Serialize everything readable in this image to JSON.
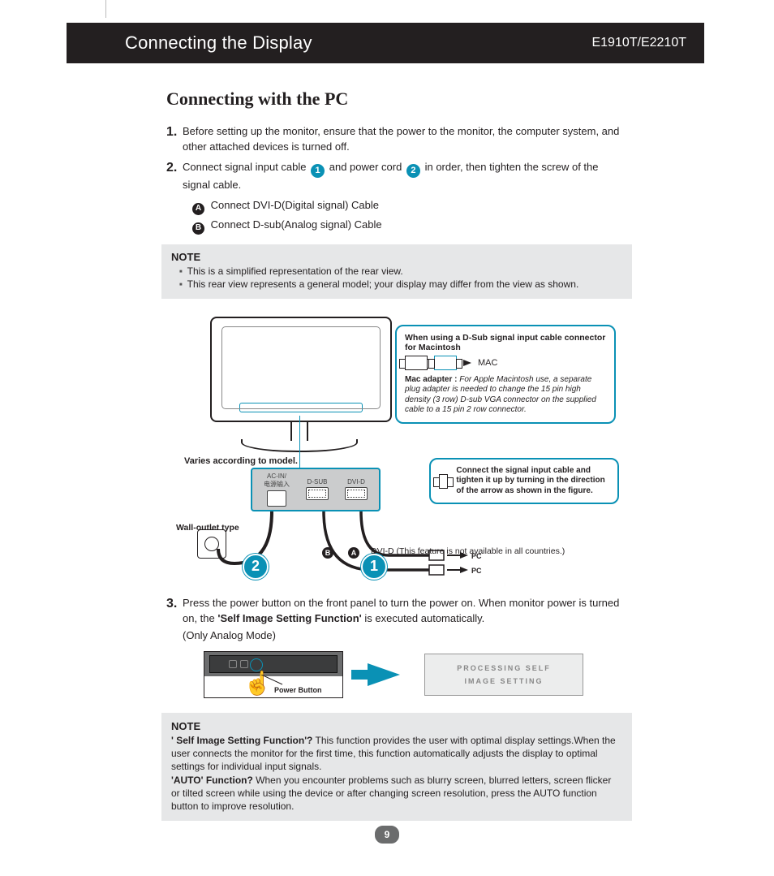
{
  "header": {
    "title": "Connecting the Display",
    "model": "E1910T/E2210T"
  },
  "section_title": "Connecting with the PC",
  "steps": {
    "s1": {
      "num": "1.",
      "text": "Before setting up the monitor, ensure that the power to the monitor, the computer system, and other attached devices is turned off."
    },
    "s2": {
      "num": "2.",
      "pre": "Connect signal input cable ",
      "mid": " and power cord ",
      "post": " in order, then tighten the screw of the signal cable.",
      "badge1": "1",
      "badge2": "2",
      "subA": {
        "l": "A",
        "t": "Connect DVI-D(Digital signal) Cable"
      },
      "subB": {
        "l": "B",
        "t": "Connect D-sub(Analog signal) Cable"
      }
    },
    "s3": {
      "num": "3.",
      "text_pre": "Press the power button on the front panel to turn the power on. When monitor power is turned on, the ",
      "bold": "'Self Image Setting Function'",
      "text_post": " is executed automatically.",
      "only": "(Only Analog Mode)"
    }
  },
  "note1": {
    "title": "NOTE",
    "items": [
      "This is a simplified representation of the rear view.",
      "This rear view represents a general model; your display may differ from the view as shown."
    ]
  },
  "diagram": {
    "varies_label": "Varies according to model.",
    "wall_label": "Wall-outlet type",
    "ports": {
      "ac": "AC-IN/\n电源输入",
      "dsub": "D-SUB",
      "dvid": "DVI-D"
    },
    "big2": "2",
    "big1": "1",
    "letterA": "A",
    "letterB": "B",
    "dvid_note": "DVI-D (This feature is not available in all countries.)",
    "pc": "PC",
    "mac_callout": {
      "title": "When using a D-Sub signal input cable connector for Macintosh",
      "mac": "MAC",
      "adapter_label": "Mac adapter :",
      "adapter_text": "For Apple Macintosh use, a separate plug adapter is needed to change the 15 pin high density (3 row) D-sub VGA connector on the supplied cable to a 15 pin  2 row connector."
    },
    "tighten_callout": "Connect the signal input cable and tighten it up by turning in the direction of the arrow as shown in the figure."
  },
  "power_illus": {
    "caption": "Power Button",
    "osd_line1": "PROCESSING SELF",
    "osd_line2": "IMAGE SETTING"
  },
  "note2": {
    "title": "NOTE",
    "q1_label": "' Self Image Setting Function'?",
    "q1_text": " This function provides the user with optimal display settings.When the user connects the monitor for the first time, this function automatically adjusts the display to optimal settings for individual input signals.",
    "q2_label": "'AUTO' Function?",
    "q2_text": " When you encounter problems such as blurry screen, blurred letters, screen flicker or tilted screen while using the device or after changing screen resolution, press the AUTO function button to improve resolution."
  },
  "page_number": "9"
}
